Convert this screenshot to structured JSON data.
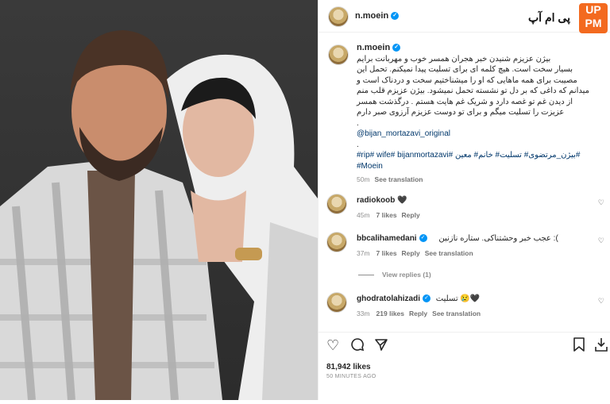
{
  "header": {
    "username": "n.moein",
    "logo_text": "پی ام آپ",
    "logo_badge": "UP PM"
  },
  "caption": {
    "username": "n.moein",
    "lines": [
      "بیژن عزیزم شنیدن خبر هجران همسر خوب و مهربانت برایم",
      "بسیار سخت است. هیچ کلمه ای برای تسلیت پیدا نمیکنم. تحمل این",
      "مصیبت برای همه ماهایی که او را میشناختیم سخت و دردناک است و",
      "میدانم که داغی که بر دل تو نشسته تحمل نمیشود. بیژن عزیزم قلب منم",
      "از دیدن غم تو غصه دارد و شریک غم هایت هستم . درگذشت همسر",
      "عزیزت را تسلیت میگم و برای تو دوست عزیزم آرزوی صبر دارم"
    ],
    "dot1": ".",
    "mention": "@bijan_mortazavi_original",
    "dot2": ".",
    "hashtags_line1": "#rip# wife# bijanmortazavi# بیژن_مرتضوی# تسلیت# خانم# معین#",
    "hashtags_line2": "#Moein",
    "time": "50m",
    "see_translation": "See translation"
  },
  "comments": [
    {
      "username": "radiokoob",
      "text": "🖤",
      "time": "45m",
      "likes": "7 likes",
      "reply": "Reply",
      "see_translation": ""
    },
    {
      "username": "bbcalihamedani",
      "text": "عجب خبر وحشتناکی. ستاره نازنین :(",
      "time": "37m",
      "likes": "7 likes",
      "reply": "Reply",
      "see_translation": "See translation"
    },
    {
      "username": "ghodratolahizadi",
      "text": "تسلیت 😢🖤",
      "time": "33m",
      "likes": "219 likes",
      "reply": "Reply",
      "see_translation": "See translation"
    }
  ],
  "view_replies": "View replies (1)",
  "likes_count": "81,942 likes",
  "posted_ago": "50 MINUTES AGO",
  "icons": {
    "like": "heart-icon",
    "comment": "comment-icon",
    "share": "send-icon",
    "save": "bookmark-icon"
  }
}
